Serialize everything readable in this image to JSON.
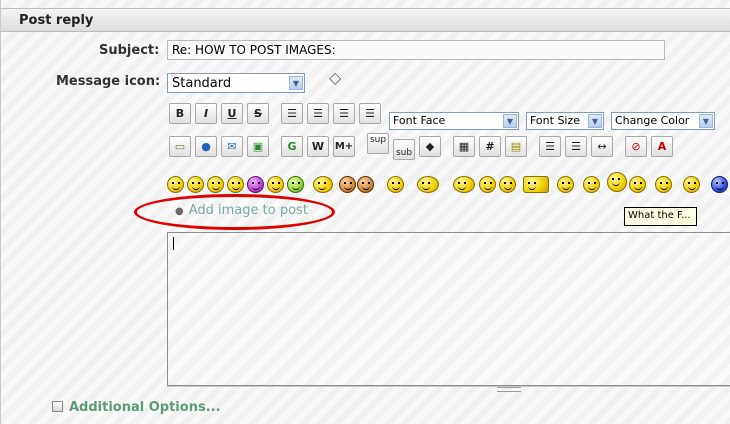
{
  "header": {
    "title": "Post reply"
  },
  "form": {
    "subject_label": "Subject:",
    "subject_value": "Re: HOW TO POST IMAGES:",
    "message_icon_label": "Message icon:",
    "message_icon_value": "Standard"
  },
  "toolbar": {
    "bold": "B",
    "italic": "I",
    "underline": "U",
    "strike": "S",
    "font_face": "Font Face",
    "font_size": "Font Size",
    "change_color": "Change Color",
    "google": "G",
    "wiki": "W",
    "more": "M+",
    "sup": "sup",
    "sub": "sub",
    "hash": "#",
    "color_a": "A"
  },
  "links": {
    "add_image": "Add image to post",
    "additional_options": "Additional Options..."
  },
  "tooltip": {
    "text": "What the F..."
  },
  "colors": {
    "accent_link": "#7aa9a0",
    "annotation": "#e00000"
  }
}
